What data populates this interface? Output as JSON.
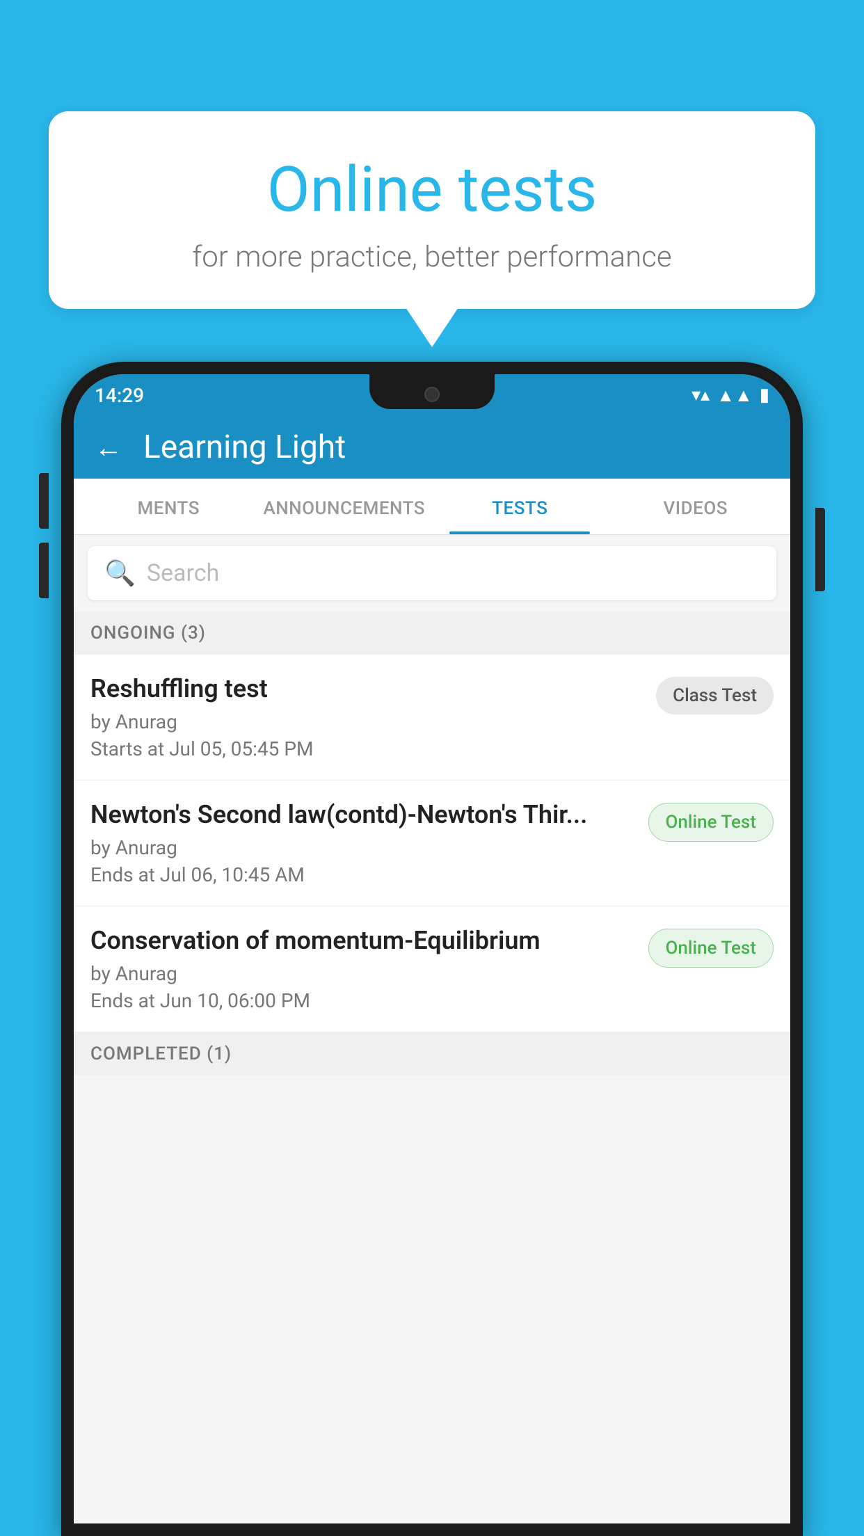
{
  "background": {
    "color": "#29b6e8"
  },
  "speech_bubble": {
    "title": "Online tests",
    "subtitle": "for more practice, better performance"
  },
  "phone": {
    "status_bar": {
      "time": "14:29",
      "wifi": "▼",
      "signal": "▲",
      "battery": "▮"
    },
    "header": {
      "back_label": "←",
      "title": "Learning Light"
    },
    "tabs": [
      {
        "label": "MENTS",
        "active": false
      },
      {
        "label": "ANNOUNCEMENTS",
        "active": false
      },
      {
        "label": "TESTS",
        "active": true
      },
      {
        "label": "VIDEOS",
        "active": false
      }
    ],
    "search": {
      "placeholder": "Search"
    },
    "sections": [
      {
        "header": "ONGOING (3)",
        "items": [
          {
            "title": "Reshuffling test",
            "author": "by Anurag",
            "time_label": "Starts at",
            "time_value": "Jul 05, 05:45 PM",
            "badge": "Class Test",
            "badge_type": "class"
          },
          {
            "title": "Newton's Second law(contd)-Newton's Thir...",
            "author": "by Anurag",
            "time_label": "Ends at",
            "time_value": "Jul 06, 10:45 AM",
            "badge": "Online Test",
            "badge_type": "online"
          },
          {
            "title": "Conservation of momentum-Equilibrium",
            "author": "by Anurag",
            "time_label": "Ends at",
            "time_value": "Jun 10, 06:00 PM",
            "badge": "Online Test",
            "badge_type": "online"
          }
        ]
      },
      {
        "header": "COMPLETED (1)",
        "items": []
      }
    ]
  }
}
